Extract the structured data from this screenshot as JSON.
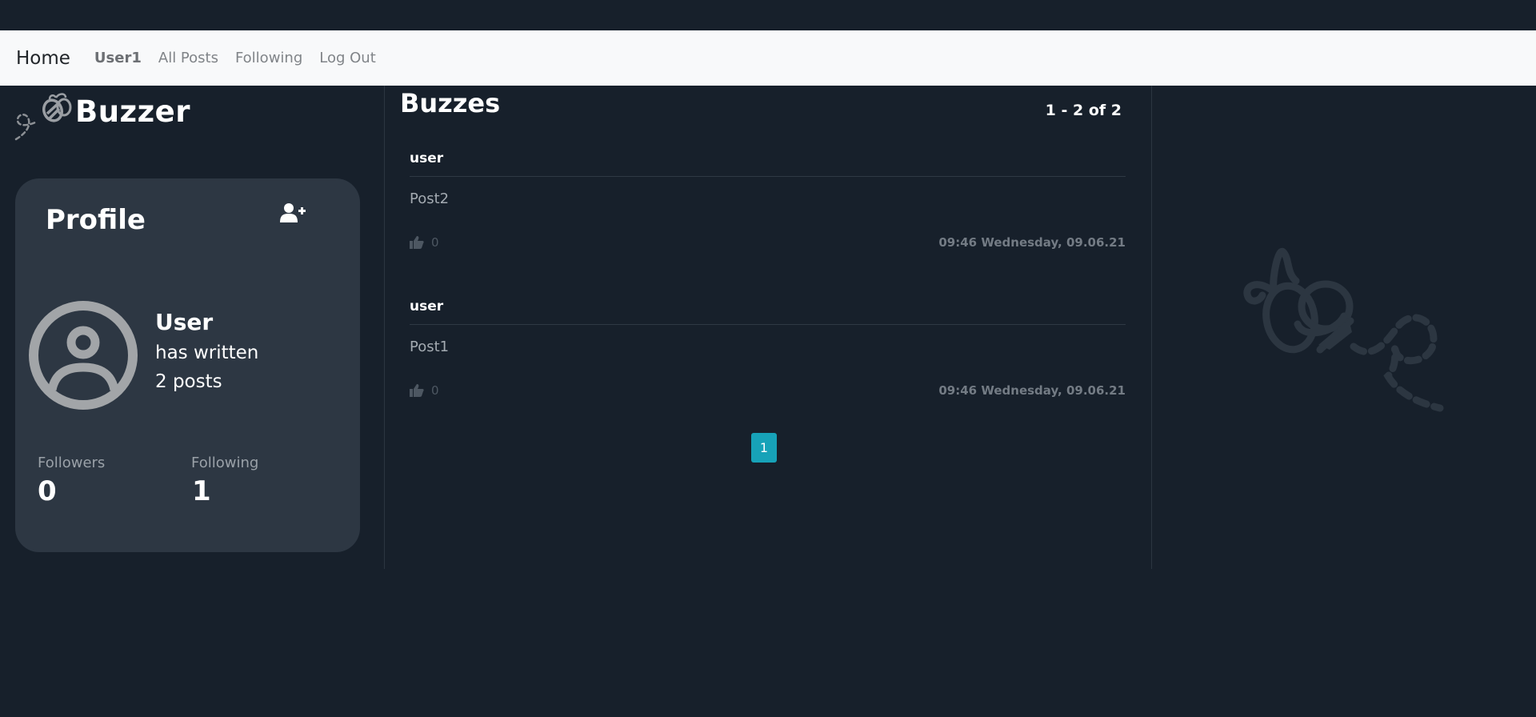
{
  "navbar": {
    "brand": "Home",
    "links": [
      "User1",
      "All Posts",
      "Following",
      "Log Out"
    ]
  },
  "logo": {
    "text": "Buzzer",
    "icon": "bee-icon"
  },
  "profile": {
    "title": "Profile",
    "follow_icon": "user-plus-icon",
    "avatar_icon": "user-circle-icon",
    "name": "User",
    "line1": "has written",
    "line2": "2 posts",
    "followers_label": "Followers",
    "followers_value": "0",
    "following_label": "Following",
    "following_value": "1"
  },
  "feed": {
    "title": "Buzzes",
    "range": "1 - 2 of 2",
    "posts": [
      {
        "user": "user",
        "body": "Post2",
        "likes": "0",
        "time": "09:46 Wednesday, 09.06.21"
      },
      {
        "user": "user",
        "body": "Post1",
        "likes": "0",
        "time": "09:46 Wednesday, 09.06.21"
      }
    ],
    "pagination": {
      "current": "1"
    }
  },
  "colors": {
    "background": "#17202b",
    "navbar": "#f8f9fa",
    "card": "#2d3743",
    "accent": "#17a2b8"
  }
}
